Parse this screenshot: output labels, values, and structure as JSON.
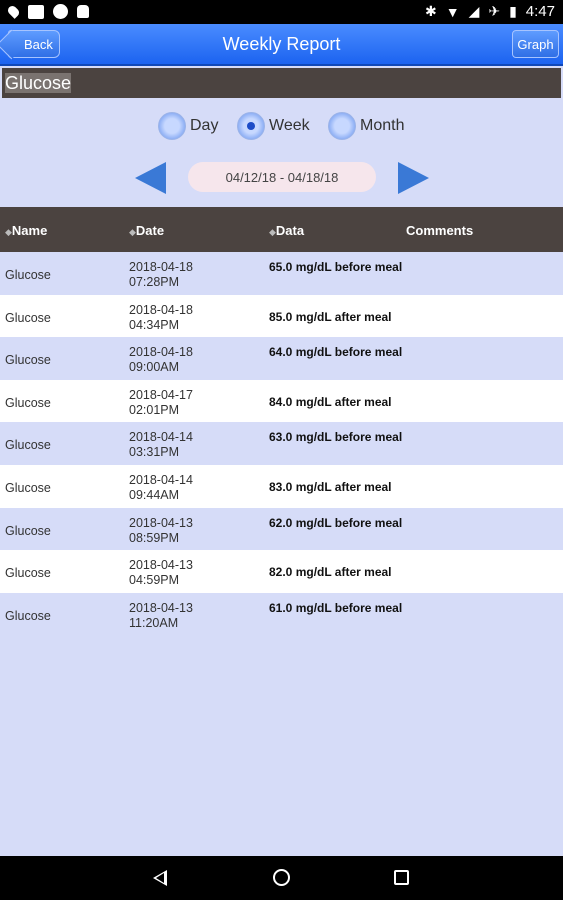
{
  "status_bar": {
    "time": "4:47"
  },
  "header": {
    "title": "Weekly Report",
    "back_label": "Back",
    "graph_label": "Graph"
  },
  "metric": {
    "selected": "Glucose"
  },
  "period": {
    "options": [
      {
        "label": "Day",
        "selected": false
      },
      {
        "label": "Week",
        "selected": true
      },
      {
        "label": "Month",
        "selected": false
      }
    ]
  },
  "date_range": "04/12/18 - 04/18/18",
  "table": {
    "columns": [
      "Name",
      "Date",
      "Data",
      "Comments"
    ],
    "rows": [
      {
        "name": "Glucose",
        "date": "2018-04-18",
        "time": "07:28PM",
        "data": "65.0 mg/dL before meal",
        "comments": ""
      },
      {
        "name": "Glucose",
        "date": "2018-04-18",
        "time": "04:34PM",
        "data": "85.0 mg/dL after meal",
        "comments": ""
      },
      {
        "name": "Glucose",
        "date": "2018-04-18",
        "time": "09:00AM",
        "data": "64.0 mg/dL before meal",
        "comments": ""
      },
      {
        "name": "Glucose",
        "date": "2018-04-17",
        "time": "02:01PM",
        "data": "84.0 mg/dL after meal",
        "comments": ""
      },
      {
        "name": "Glucose",
        "date": "2018-04-14",
        "time": "03:31PM",
        "data": "63.0 mg/dL before meal",
        "comments": ""
      },
      {
        "name": "Glucose",
        "date": "2018-04-14",
        "time": "09:44AM",
        "data": "83.0 mg/dL after meal",
        "comments": ""
      },
      {
        "name": "Glucose",
        "date": "2018-04-13",
        "time": "08:59PM",
        "data": "62.0 mg/dL before meal",
        "comments": ""
      },
      {
        "name": "Glucose",
        "date": "2018-04-13",
        "time": "04:59PM",
        "data": "82.0 mg/dL after meal",
        "comments": ""
      },
      {
        "name": "Glucose",
        "date": "2018-04-13",
        "time": "11:20AM",
        "data": "61.0 mg/dL before meal",
        "comments": ""
      }
    ]
  },
  "colors": {
    "accent": "#1c63f0",
    "header_dark": "#4b4340",
    "row_alt": "#d6dcf8",
    "arrow": "#3a79d6"
  }
}
